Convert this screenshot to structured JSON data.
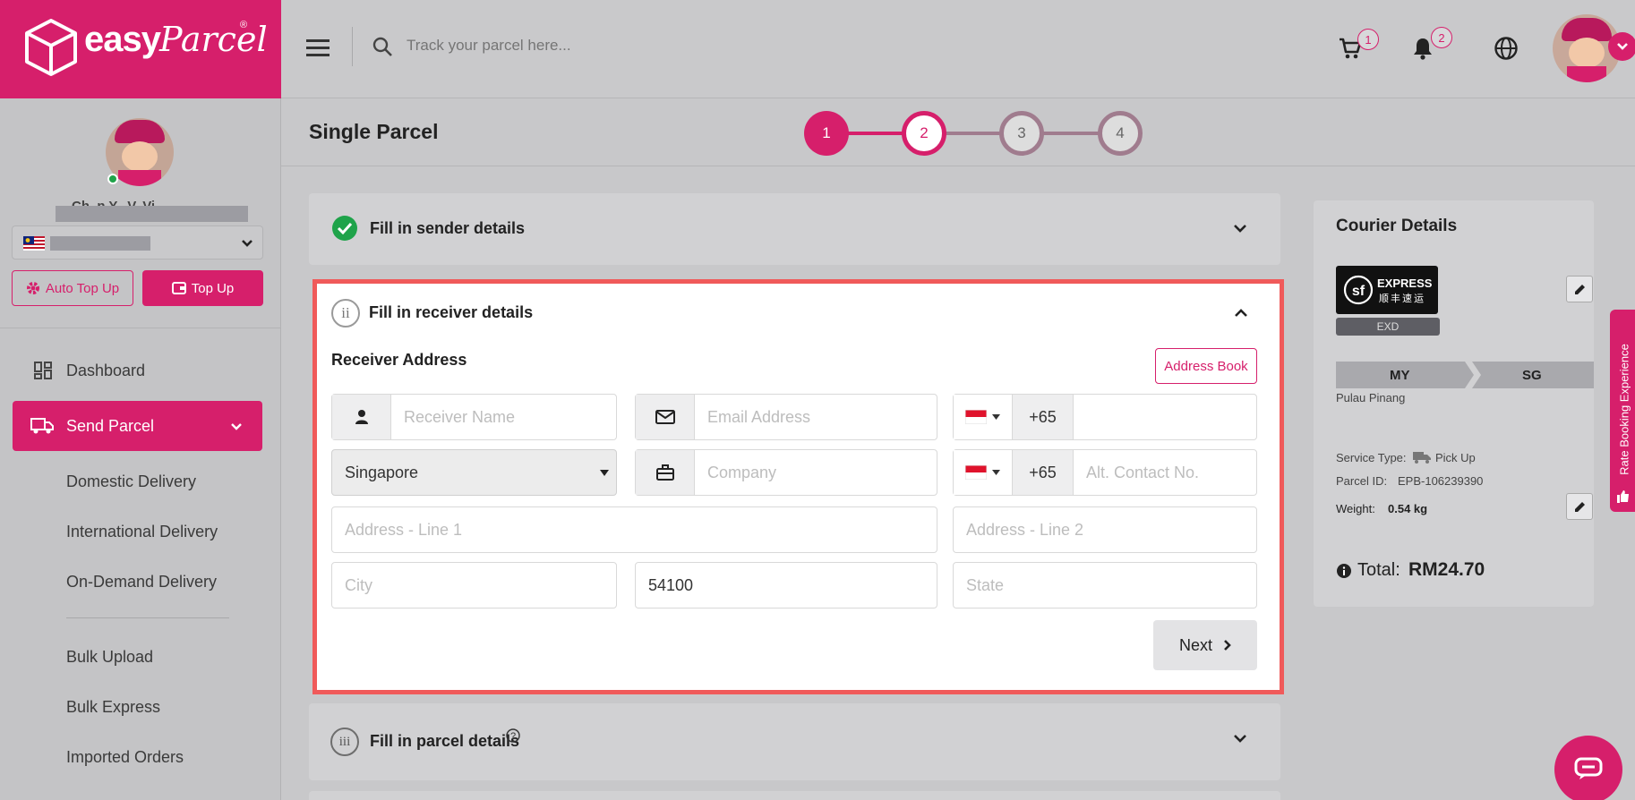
{
  "brand": {
    "name": "easy",
    "name_script": "Parcel",
    "reg": "®"
  },
  "header": {
    "search_placeholder": "Track your parcel here...",
    "cart_count": "1",
    "notification_count": "2"
  },
  "sidebar": {
    "user_name_partial": "Ch..n Y.. V. Vi..",
    "auto_topup_label": "Auto Top Up",
    "topup_label": "Top Up",
    "nav": {
      "dashboard": "Dashboard",
      "send_parcel": "Send Parcel",
      "domestic": "Domestic Delivery",
      "international": "International Delivery",
      "on_demand": "On-Demand Delivery",
      "bulk_upload": "Bulk Upload",
      "bulk_express": "Bulk Express",
      "imported_orders": "Imported Orders"
    }
  },
  "page": {
    "title": "Single Parcel"
  },
  "stepper": {
    "steps": [
      "1",
      "2",
      "3",
      "4"
    ],
    "current": 2
  },
  "sections": {
    "sender": {
      "title": "Fill in sender details"
    },
    "receiver": {
      "title": "Fill in receiver details",
      "numeral": "ii"
    },
    "parcel": {
      "title": "Fill in parcel details",
      "numeral": "iii"
    }
  },
  "receiver_form": {
    "heading": "Receiver Address",
    "address_book_label": "Address Book",
    "name_placeholder": "Receiver Name",
    "email_placeholder": "Email Address",
    "phone_code": "+65",
    "country_value": "Singapore",
    "company_placeholder": "Company",
    "alt_phone_code": "+65",
    "alt_contact_placeholder": "Alt. Contact No.",
    "address1_placeholder": "Address - Line 1",
    "address2_placeholder": "Address - Line 2",
    "city_placeholder": "City",
    "postcode_value": "54100",
    "state_placeholder": "State",
    "next_label": "Next"
  },
  "courier": {
    "heading": "Courier Details",
    "logo_line1": "EXPRESS",
    "logo_line2": "顺丰速运",
    "service_code": "EXD",
    "origin": "MY",
    "destination": "SG",
    "origin_state": "Pulau Pinang",
    "service_type_label": "Service Type:",
    "service_type_value": "Pick Up",
    "parcel_id_label": "Parcel ID:",
    "parcel_id_value": "EPB-106239390",
    "weight_label": "Weight:",
    "weight_value": "0.54 kg",
    "total_label": "Total:",
    "total_value": "RM24.70"
  },
  "side_tab": {
    "label": "Rate Booking Experience"
  },
  "colors": {
    "brand": "#d61f6b",
    "highlight": "#f05a5a",
    "success": "#1fa34a"
  }
}
